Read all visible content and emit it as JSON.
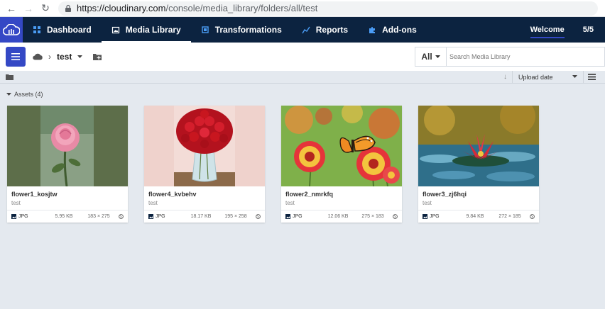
{
  "browser": {
    "url_host": "https://cloudinary.com",
    "url_path": "/console/media_library/folders/all/test"
  },
  "header": {
    "nav": [
      {
        "label": "Dashboard",
        "icon": "dashboard-icon"
      },
      {
        "label": "Media Library",
        "icon": "media-library-icon",
        "active": true
      },
      {
        "label": "Transformations",
        "icon": "transformations-icon"
      },
      {
        "label": "Reports",
        "icon": "reports-icon"
      },
      {
        "label": "Add-ons",
        "icon": "puzzle-icon"
      }
    ],
    "welcome": "Welcome",
    "counter": "5/5"
  },
  "toolbar": {
    "folder": "test",
    "search_scope": "All",
    "search_placeholder": "Search Media Library"
  },
  "sortbar": {
    "sort_by": "Upload date"
  },
  "assets": {
    "label": "Assets (4)",
    "items": [
      {
        "name": "flower1_kosjtw",
        "folder": "test",
        "format": "JPG",
        "size": "5.95 KB",
        "dims": "183 × 275"
      },
      {
        "name": "flower4_kvbehv",
        "folder": "test",
        "format": "JPG",
        "size": "18.17 KB",
        "dims": "195 × 258"
      },
      {
        "name": "flower2_nmrkfq",
        "folder": "test",
        "format": "JPG",
        "size": "12.06 KB",
        "dims": "275 × 183"
      },
      {
        "name": "flower3_zj6hqi",
        "folder": "test",
        "format": "JPG",
        "size": "9.84 KB",
        "dims": "272 × 185"
      }
    ]
  },
  "colors": {
    "header_bg": "#0c2340",
    "accent": "#3448c5",
    "page_bg": "#e4e9ef"
  }
}
